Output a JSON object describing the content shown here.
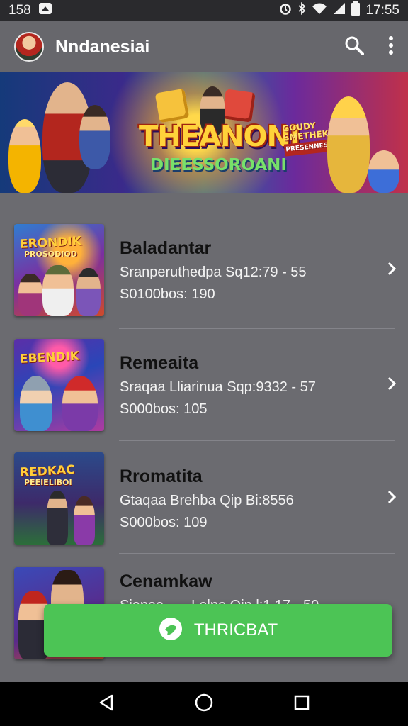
{
  "status_bar": {
    "left_text": "158",
    "time": "17:55",
    "icons": [
      "notification-icon",
      "alarm-icon",
      "bluetooth-icon",
      "wifi-icon",
      "signal-icon",
      "battery-icon"
    ]
  },
  "app_bar": {
    "title": "Nndanesiai",
    "icons": [
      "search-icon",
      "more-vert-icon"
    ]
  },
  "banner": {
    "title": "THEANONI",
    "subtitle": "DIEESSOROANI",
    "side_title": "GOUDY SMETHEK",
    "side_sub": "PRESENNESSTIK"
  },
  "list": {
    "items": [
      {
        "title": "Baladantar",
        "line1": "Sranperuthedpa Sq12:79 - 55",
        "line2": "S0100bos: 190",
        "thumb_title": "ERONDIK",
        "thumb_sub": "PROSODIOD"
      },
      {
        "title": "Remeaita",
        "line1": "Sraqaa Lliarinua Sqp:9332 - 57",
        "line2": "S000bos: 105",
        "thumb_title": "EBENDIK",
        "thumb_sub": ""
      },
      {
        "title": "Rromatita",
        "line1": "Gtaqaa Brehba Qip Bi:8556",
        "line2": "S000bos: 109",
        "thumb_title": "REDKAC",
        "thumb_sub": "PEEIELIBOI"
      },
      {
        "title": "Cenamkaw",
        "line1": "Sianaa . . . Lolno Qin l:1 17 - 50",
        "line2": "",
        "thumb_title": "",
        "thumb_sub": ""
      }
    ]
  },
  "fab": {
    "label": "THRICBAT",
    "icon": "chat-bubble-icon"
  },
  "nav_bar": {
    "icons": [
      "back-icon",
      "home-icon",
      "recents-icon"
    ]
  },
  "colors": {
    "background": "#6b6b70",
    "app_bar": "#67676c",
    "fab": "#4cc455",
    "status_bar": "#2a2a2d"
  }
}
